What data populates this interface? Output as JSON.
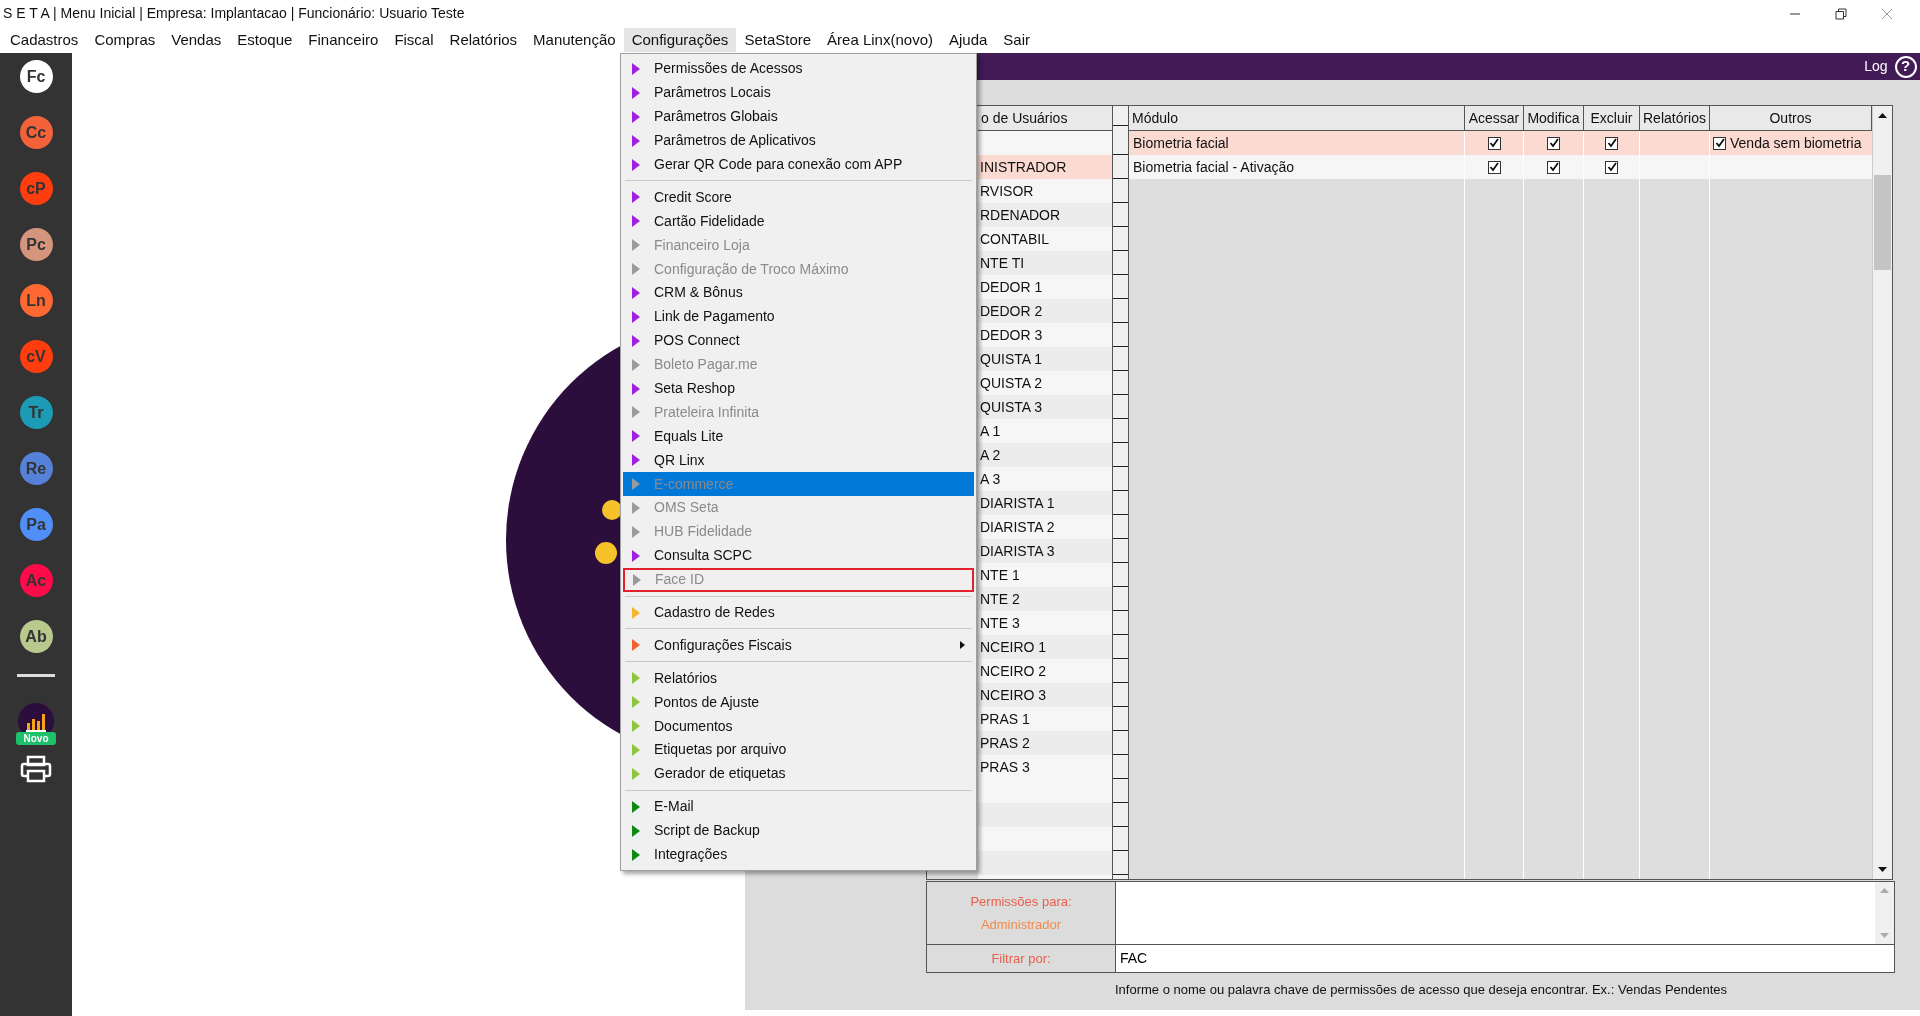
{
  "window": {
    "title": "S E T A | Menu Inicial | Empresa: Implantacao | Funcionário: Usuario Teste"
  },
  "menubar": [
    {
      "label": "Cadastros",
      "selected": false
    },
    {
      "label": "Compras",
      "selected": false
    },
    {
      "label": "Vendas",
      "selected": false
    },
    {
      "label": "Estoque",
      "selected": false
    },
    {
      "label": "Financeiro",
      "selected": false
    },
    {
      "label": "Fiscal",
      "selected": false
    },
    {
      "label": "Relatórios",
      "selected": false
    },
    {
      "label": "Manutenção",
      "selected": false
    },
    {
      "label": "Configurações",
      "selected": true
    },
    {
      "label": "SetaStore",
      "selected": false
    },
    {
      "label": "Área Linx(novo)",
      "selected": false
    },
    {
      "label": "Ajuda",
      "selected": false
    },
    {
      "label": "Sair",
      "selected": false
    }
  ],
  "sidebar": {
    "apps": [
      {
        "label": "Fc",
        "color": "#ffffff"
      },
      {
        "label": "Cc",
        "color": "#f4623a"
      },
      {
        "label": "cP",
        "color": "#ff3d0f"
      },
      {
        "label": "Pc",
        "color": "#d4957c"
      },
      {
        "label": "Ln",
        "color": "#ff6831"
      },
      {
        "label": "cV",
        "color": "#ff3d0f"
      },
      {
        "label": "Tr",
        "color": "#1b9bb6"
      },
      {
        "label": "Re",
        "color": "#5581d9"
      },
      {
        "label": "Pa",
        "color": "#4f8ff7"
      },
      {
        "label": "Ac",
        "color": "#ff0b4a"
      },
      {
        "label": "Ab",
        "color": "#b9c98e"
      }
    ],
    "badge": "Novo"
  },
  "dropdown": {
    "sections": [
      [
        {
          "label": "Permissões de Acessos",
          "color": "#a11fe0",
          "disabled": false,
          "selected": false,
          "boxed": false,
          "submenu": false
        },
        {
          "label": "Parâmetros Locais",
          "color": "#a11fe0",
          "disabled": false,
          "selected": false,
          "boxed": false,
          "submenu": false
        },
        {
          "label": "Parâmetros Globais",
          "color": "#a11fe0",
          "disabled": false,
          "selected": false,
          "boxed": false,
          "submenu": false
        },
        {
          "label": "Parâmetros de Aplicativos",
          "color": "#a11fe0",
          "disabled": false,
          "selected": false,
          "boxed": false,
          "submenu": false
        },
        {
          "label": "Gerar QR Code para conexão com APP",
          "color": "#a11fe0",
          "disabled": false,
          "selected": false,
          "boxed": false,
          "submenu": false
        }
      ],
      [
        {
          "label": "Credit Score",
          "color": "#a11fe0",
          "disabled": false,
          "selected": false,
          "boxed": false,
          "submenu": false
        },
        {
          "label": "Cartão Fidelidade",
          "color": "#a11fe0",
          "disabled": false,
          "selected": false,
          "boxed": false,
          "submenu": false
        },
        {
          "label": "Financeiro Loja",
          "color": "#9a9a9a",
          "disabled": true,
          "selected": false,
          "boxed": false,
          "submenu": false
        },
        {
          "label": "Configuração de Troco Máximo",
          "color": "#9a9a9a",
          "disabled": true,
          "selected": false,
          "boxed": false,
          "submenu": false
        },
        {
          "label": "CRM & Bônus",
          "color": "#a11fe0",
          "disabled": false,
          "selected": false,
          "boxed": false,
          "submenu": false
        },
        {
          "label": "Link de Pagamento",
          "color": "#a11fe0",
          "disabled": false,
          "selected": false,
          "boxed": false,
          "submenu": false
        },
        {
          "label": "POS Connect",
          "color": "#a11fe0",
          "disabled": false,
          "selected": false,
          "boxed": false,
          "submenu": false
        },
        {
          "label": "Boleto Pagar.me",
          "color": "#9a9a9a",
          "disabled": true,
          "selected": false,
          "boxed": false,
          "submenu": false
        },
        {
          "label": "Seta Reshop",
          "color": "#a11fe0",
          "disabled": false,
          "selected": false,
          "boxed": false,
          "submenu": false
        },
        {
          "label": "Prateleira Infinita",
          "color": "#9a9a9a",
          "disabled": true,
          "selected": false,
          "boxed": false,
          "submenu": false
        },
        {
          "label": "Equals Lite",
          "color": "#a11fe0",
          "disabled": false,
          "selected": false,
          "boxed": false,
          "submenu": false
        },
        {
          "label": "QR Linx",
          "color": "#a11fe0",
          "disabled": false,
          "selected": false,
          "boxed": false,
          "submenu": false
        },
        {
          "label": "E-commerce",
          "color": "#9a9a9a",
          "disabled": true,
          "selected": true,
          "boxed": false,
          "submenu": false
        },
        {
          "label": "OMS Seta",
          "color": "#9a9a9a",
          "disabled": true,
          "selected": false,
          "boxed": false,
          "submenu": false
        },
        {
          "label": "HUB Fidelidade",
          "color": "#9a9a9a",
          "disabled": true,
          "selected": false,
          "boxed": false,
          "submenu": false
        },
        {
          "label": "Consulta SCPC",
          "color": "#a11fe0",
          "disabled": false,
          "selected": false,
          "boxed": false,
          "submenu": false
        },
        {
          "label": "Face ID",
          "color": "#9a9a9a",
          "disabled": true,
          "selected": false,
          "boxed": true,
          "submenu": false
        }
      ],
      [
        {
          "label": "Cadastro de Redes",
          "color": "#f6b52f",
          "disabled": false,
          "selected": false,
          "boxed": false,
          "submenu": false
        }
      ],
      [
        {
          "label": "Configurações Fiscais",
          "color": "#f2622d",
          "disabled": false,
          "selected": false,
          "boxed": false,
          "submenu": true
        }
      ],
      [
        {
          "label": "Relatórios",
          "color": "#8dc63f",
          "disabled": false,
          "selected": false,
          "boxed": false,
          "submenu": false
        },
        {
          "label": "Pontos de Ajuste",
          "color": "#8dc63f",
          "disabled": false,
          "selected": false,
          "boxed": false,
          "submenu": false
        },
        {
          "label": "Documentos",
          "color": "#8dc63f",
          "disabled": false,
          "selected": false,
          "boxed": false,
          "submenu": false
        },
        {
          "label": "Etiquetas por arquivo",
          "color": "#8dc63f",
          "disabled": false,
          "selected": false,
          "boxed": false,
          "submenu": false
        },
        {
          "label": "Gerador de etiquetas",
          "color": "#8dc63f",
          "disabled": false,
          "selected": false,
          "boxed": false,
          "submenu": false
        }
      ],
      [
        {
          "label": "E-Mail",
          "color": "#0a8a12",
          "disabled": false,
          "selected": false,
          "boxed": false,
          "submenu": false
        },
        {
          "label": "Script de Backup",
          "color": "#0a8a12",
          "disabled": false,
          "selected": false,
          "boxed": false,
          "submenu": false
        },
        {
          "label": "Integrações",
          "color": "#0a8a12",
          "disabled": false,
          "selected": false,
          "boxed": false,
          "submenu": false
        }
      ]
    ]
  },
  "panel": {
    "log": "Log",
    "help": "?",
    "users": {
      "header": "o de Usuários",
      "rows": [
        {
          "label": "INISTRADOR",
          "selected": true
        },
        {
          "label": "RVISOR",
          "selected": false
        },
        {
          "label": "RDENADOR",
          "selected": false
        },
        {
          "label": "CONTABIL",
          "selected": false
        },
        {
          "label": "NTE TI",
          "selected": false
        },
        {
          "label": "DEDOR 1",
          "selected": false
        },
        {
          "label": "DEDOR 2",
          "selected": false
        },
        {
          "label": "DEDOR 3",
          "selected": false
        },
        {
          "label": "QUISTA 1",
          "selected": false
        },
        {
          "label": "QUISTA 2",
          "selected": false
        },
        {
          "label": "QUISTA 3",
          "selected": false
        },
        {
          "label": "A 1",
          "selected": false
        },
        {
          "label": "A 2",
          "selected": false
        },
        {
          "label": "A 3",
          "selected": false
        },
        {
          "label": "DIARISTA 1",
          "selected": false
        },
        {
          "label": "DIARISTA 2",
          "selected": false
        },
        {
          "label": "DIARISTA 3",
          "selected": false
        },
        {
          "label": "NTE 1",
          "selected": false
        },
        {
          "label": "NTE 2",
          "selected": false
        },
        {
          "label": "NTE 3",
          "selected": false
        },
        {
          "label": "NCEIRO 1",
          "selected": false
        },
        {
          "label": "NCEIRO 2",
          "selected": false
        },
        {
          "label": "NCEIRO 3",
          "selected": false
        },
        {
          "label": "PRAS 1",
          "selected": false
        },
        {
          "label": "PRAS 2",
          "selected": false
        },
        {
          "label": "PRAS 3",
          "selected": false
        }
      ]
    },
    "columns": [
      "Módulo",
      "Acessar",
      "Modifica",
      "Excluir",
      "Relatórios",
      "Outros"
    ],
    "rows": [
      {
        "module": "Biometria facial",
        "selected": true,
        "flags": [
          true,
          true,
          true
        ],
        "other": {
          "label": "Venda sem biometria",
          "checked": true
        }
      },
      {
        "module": "Biometria facial - Ativação",
        "selected": false,
        "flags": [
          true,
          true,
          true
        ]
      }
    ],
    "permissions_label": "Permissões para:",
    "permissions_user": "Administrador",
    "filter_label": "Filtrar por:",
    "filter_value": "FAC",
    "hint": "Informe o nome ou palavra chave de permissões de acesso que deseja encontrar. Ex.: Vendas Pendentes"
  }
}
